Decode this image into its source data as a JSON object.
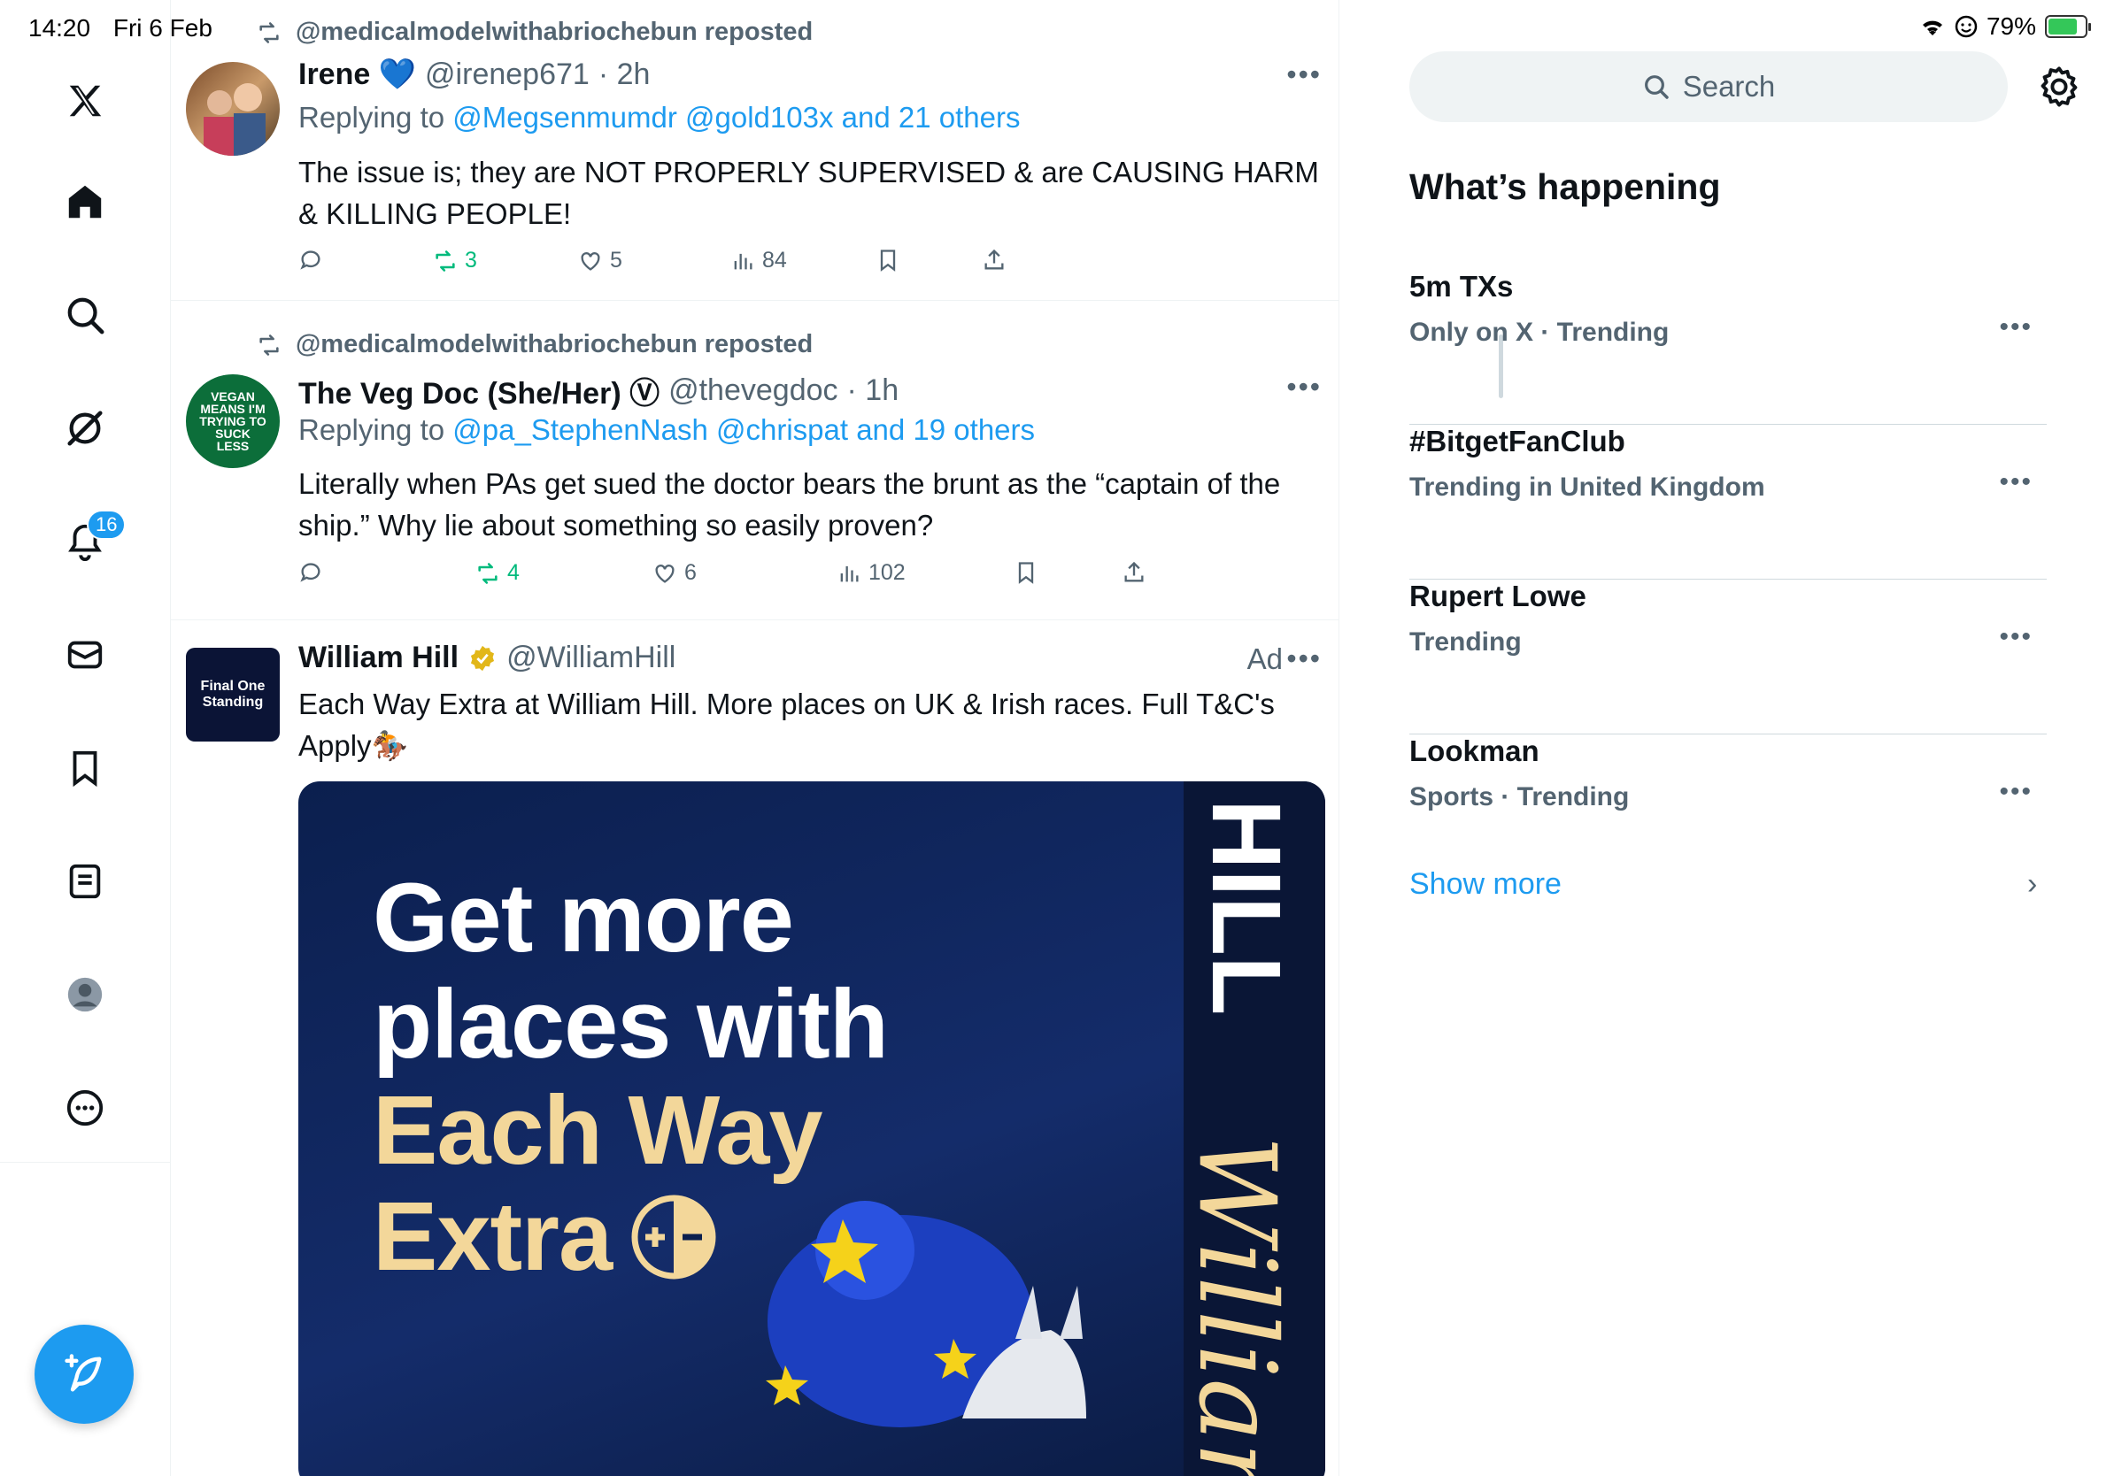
{
  "status_bar": {
    "time": "14:20",
    "date": "Fri 6 Feb",
    "battery": "79%",
    "battery_level": 0.79
  },
  "nav": {
    "items": [
      "x-logo-icon",
      "home-icon",
      "search-icon",
      "grok-icon",
      "bell-icon",
      "mail-icon",
      "bookmark-icon",
      "list-icon",
      "profile-icon",
      "more-icon"
    ],
    "notifications_badge": "16"
  },
  "posts": [
    {
      "repost_by": "@medicalmodelwithabriochebun reposted",
      "name": "Irene 💙",
      "handle": "@irenep671",
      "time": "· 2h",
      "reply_prefix": "Replying to",
      "reply_to": "@Megsenmumdr @gold103x and 21 others",
      "text": "The issue is; they are NOT PROPERLY SUPERVISED & are CAUSING HARM & KILLING PEOPLE!",
      "reposts": "3",
      "likes": "5",
      "views": "84"
    },
    {
      "repost_by": "@medicalmodelwithabriochebun reposted",
      "name": "The Veg Doc (She/Her) Ⓥ",
      "handle": "@thevegdoc",
      "time": "· 1h",
      "reply_prefix": "Replying to",
      "reply_to": "@pa_StephenNash @chrispat and 19 others",
      "text": "Literally when PAs get sued the doctor bears the brunt as the “captain of the ship.” Why lie about something so easily proven?",
      "avatar_text": "VEGAN MEANS I'M TRYING TO SUCK LESS",
      "reposts": "4",
      "likes": "6",
      "views": "102"
    },
    {
      "name": "William Hill",
      "handle": "@WilliamHill",
      "ad_label": "Ad",
      "text": "Each Way Extra at William Hill. More places on UK & Irish races. Full T&C's Apply🏇",
      "avatar_text": "Final One Standing",
      "image": {
        "line1": "Get more",
        "line2": "places with",
        "line3": "Each Way",
        "line4": "Extra",
        "brand": "HILL",
        "script": "William"
      }
    }
  ],
  "sidebar": {
    "search_placeholder": "Search",
    "title": "What’s happening",
    "trends": [
      {
        "title": "5m TXs",
        "subtitle": "Only on X · Trending"
      },
      {
        "title": "#BitgetFanClub",
        "subtitle": "Trending in United Kingdom"
      },
      {
        "title": "Rupert Lowe",
        "subtitle": "Trending"
      },
      {
        "title": "Lookman",
        "subtitle": "Sports · Trending"
      }
    ],
    "show_more": "Show more"
  },
  "colors": {
    "accent": "#1d9bf0",
    "muted": "#536471",
    "repost_green": "#00ba7c",
    "ad_gold": "#f3d79a",
    "ad_navy": "#0b1f4e"
  }
}
